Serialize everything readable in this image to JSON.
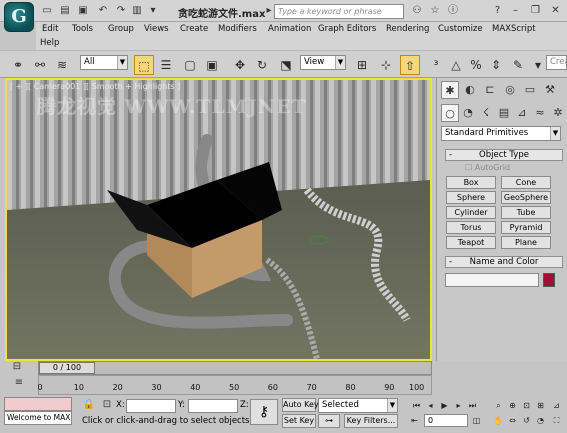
{
  "app": {
    "logo_glyph": "G",
    "title": "贪吃蛇游文件.max",
    "search_placeholder": "Type a keyword or phrase",
    "title_icons": [
      "new-icon",
      "open-icon",
      "save-icon",
      "undo-icon",
      "redo-icon",
      "dropdown-icon"
    ],
    "window_buttons": [
      "help-icon",
      "minimize-icon",
      "restore-icon",
      "close-icon"
    ]
  },
  "menu": {
    "items": [
      "Edit",
      "Tools",
      "Group",
      "Views",
      "Create",
      "Modifiers",
      "Animation",
      "Graph Editors",
      "Rendering",
      "Customize",
      "MAXScript",
      "Help"
    ]
  },
  "toolbar": {
    "selection_filter": "All",
    "reference_coord": "View",
    "named_selection_placeholder": "Crea"
  },
  "viewport": {
    "label": "[ + ][ Camera001 ][ Smooth + Highlights ]",
    "watermark": "腾龙视觉 WWW.TLMJNET",
    "border_color": "#f0e040"
  },
  "command_panel": {
    "category_dropdown": "Standard Primitives",
    "object_type_header": "Object Type",
    "autogrid_label": "AutoGrid",
    "buttons": [
      "Box",
      "Cone",
      "Sphere",
      "GeoSphere",
      "Cylinder",
      "Tube",
      "Torus",
      "Pyramid",
      "Teapot",
      "Plane"
    ],
    "name_color_header": "Name and Color",
    "object_color": "#a0103a"
  },
  "time": {
    "slider_label": "0 / 100",
    "ticks": [
      "0",
      "10",
      "20",
      "30",
      "40",
      "50",
      "60",
      "70",
      "80",
      "90",
      "100"
    ]
  },
  "status": {
    "maxscript_text": "Welcome to MAX!",
    "x_label": "X:",
    "y_label": "Y:",
    "z_label": "Z:",
    "prompt": "Click or click-and-drag to select objects",
    "auto_key": "Auto Key",
    "set_key": "Set Key",
    "key_mode": "Selected",
    "key_filters": "Key Filters...",
    "frame_value": "0"
  }
}
